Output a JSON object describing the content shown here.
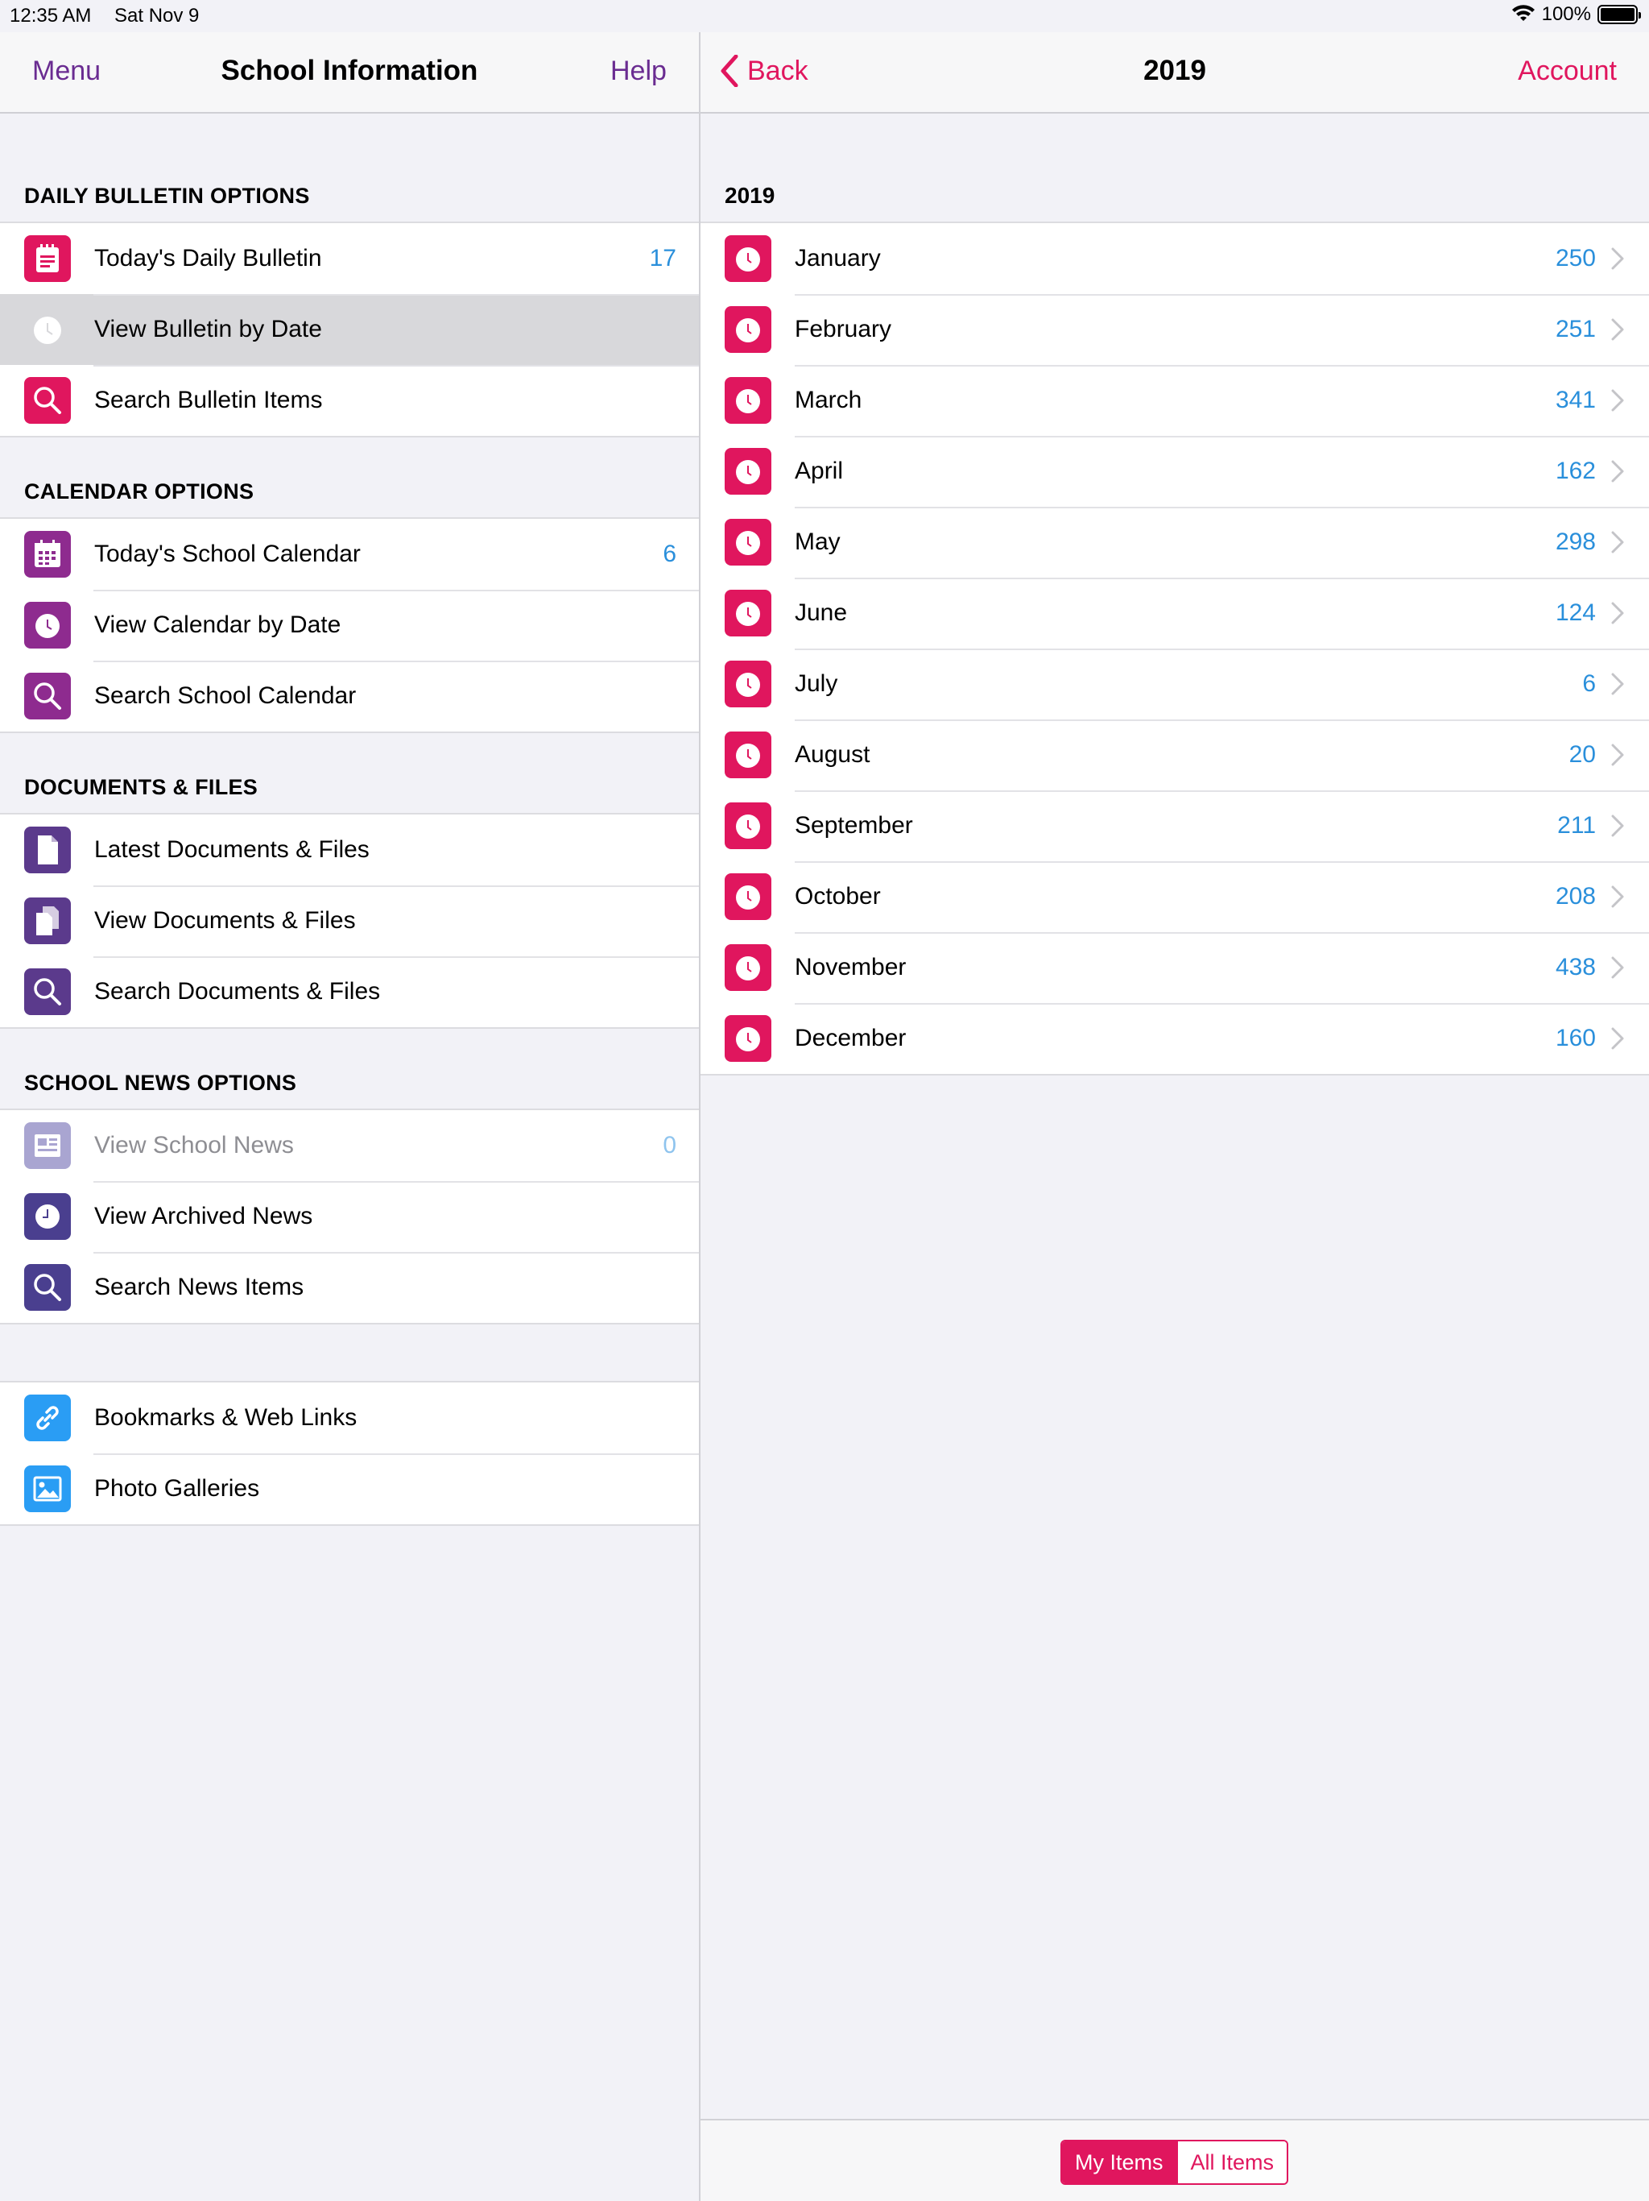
{
  "status": {
    "time": "12:35 AM",
    "date": "Sat Nov 9",
    "battery": "100%",
    "battery_level": 1.0
  },
  "left_nav": {
    "menu": "Menu",
    "title": "School Information",
    "help": "Help"
  },
  "right_nav": {
    "back": "Back",
    "title": "2019",
    "account": "Account"
  },
  "sections": {
    "bulletin": {
      "header": "DAILY BULLETIN OPTIONS",
      "items": [
        {
          "label": "Today's Daily Bulletin",
          "count": "17",
          "icon": "bulletin-icon"
        },
        {
          "label": "View Bulletin by Date",
          "count": "",
          "icon": "clock-icon"
        },
        {
          "label": "Search Bulletin Items",
          "count": "",
          "icon": "search-icon"
        }
      ]
    },
    "calendar": {
      "header": "CALENDAR OPTIONS",
      "items": [
        {
          "label": "Today's School Calendar",
          "count": "6",
          "icon": "calendar-icon"
        },
        {
          "label": "View Calendar by Date",
          "count": "",
          "icon": "clock-icon"
        },
        {
          "label": "Search School Calendar",
          "count": "",
          "icon": "search-icon"
        }
      ]
    },
    "documents": {
      "header": "DOCUMENTS & FILES",
      "items": [
        {
          "label": "Latest Documents & Files",
          "count": "",
          "icon": "document-icon"
        },
        {
          "label": "View Documents & Files",
          "count": "",
          "icon": "documents-icon"
        },
        {
          "label": "Search Documents & Files",
          "count": "",
          "icon": "search-icon"
        }
      ]
    },
    "news": {
      "header": "SCHOOL NEWS OPTIONS",
      "items": [
        {
          "label": "View School News",
          "count": "0",
          "icon": "newspaper-icon"
        },
        {
          "label": "View Archived News",
          "count": "",
          "icon": "clock-icon"
        },
        {
          "label": "Search News Items",
          "count": "",
          "icon": "search-icon"
        }
      ]
    },
    "other": {
      "items": [
        {
          "label": "Bookmarks & Web Links",
          "icon": "link-icon"
        },
        {
          "label": "Photo Galleries",
          "icon": "photo-icon"
        }
      ]
    }
  },
  "year": {
    "header": "2019",
    "months": [
      {
        "label": "January",
        "count": "250"
      },
      {
        "label": "February",
        "count": "251"
      },
      {
        "label": "March",
        "count": "341"
      },
      {
        "label": "April",
        "count": "162"
      },
      {
        "label": "May",
        "count": "298"
      },
      {
        "label": "June",
        "count": "124"
      },
      {
        "label": "July",
        "count": "6"
      },
      {
        "label": "August",
        "count": "20"
      },
      {
        "label": "September",
        "count": "211"
      },
      {
        "label": "October",
        "count": "208"
      },
      {
        "label": "November",
        "count": "438"
      },
      {
        "label": "December",
        "count": "160"
      }
    ]
  },
  "toolbar": {
    "my_items": "My Items",
    "all_items": "All Items"
  },
  "colors": {
    "pink": "#e0165e",
    "purple": "#6a2c91",
    "violet": "#5b3a8c",
    "indigo": "#4a3f8f",
    "blue": "#2a9df4",
    "count_blue": "#2a8fdb"
  }
}
